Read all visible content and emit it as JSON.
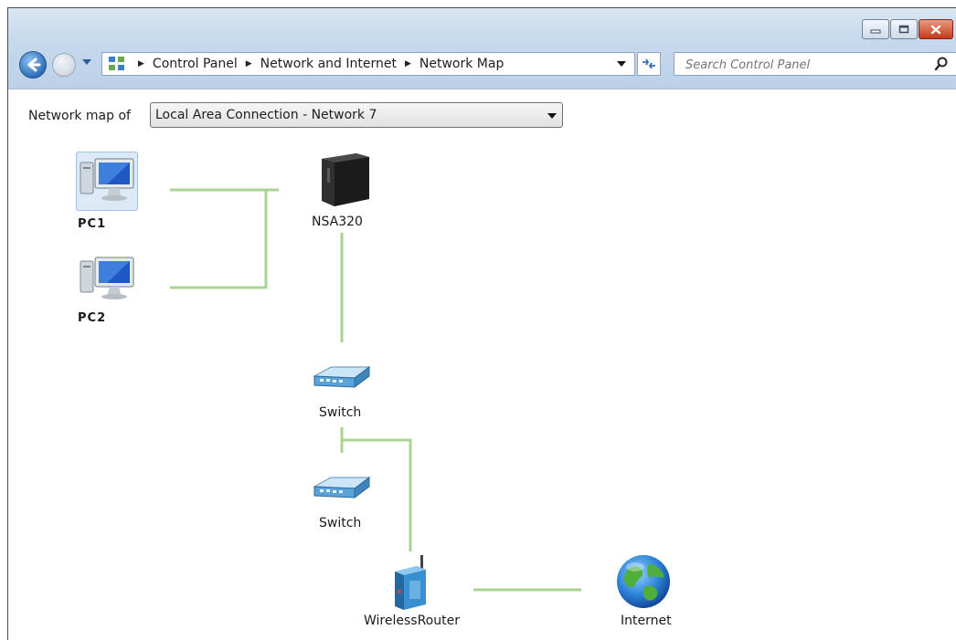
{
  "window": {
    "caption_buttons": [
      "minimize",
      "maximize",
      "close"
    ]
  },
  "address_bar": {
    "breadcrumbs": [
      "Control Panel",
      "Network and Internet",
      "Network Map"
    ]
  },
  "search": {
    "placeholder": "Search Control Panel"
  },
  "network_map": {
    "label": "Network map of",
    "selected_network": "Local Area Connection - Network  7"
  },
  "devices": {
    "pc1": "PC1",
    "pc2": "PC2",
    "nas": "NSA320",
    "switch1": "Switch",
    "switch2": "Switch",
    "router": "WirelessRouter",
    "internet": "Internet"
  },
  "colors": {
    "link_line": "#a9d48f",
    "title_bar": "#c5d8ec",
    "close_button": "#c43a1c",
    "back_button": "#2f6fb8"
  }
}
